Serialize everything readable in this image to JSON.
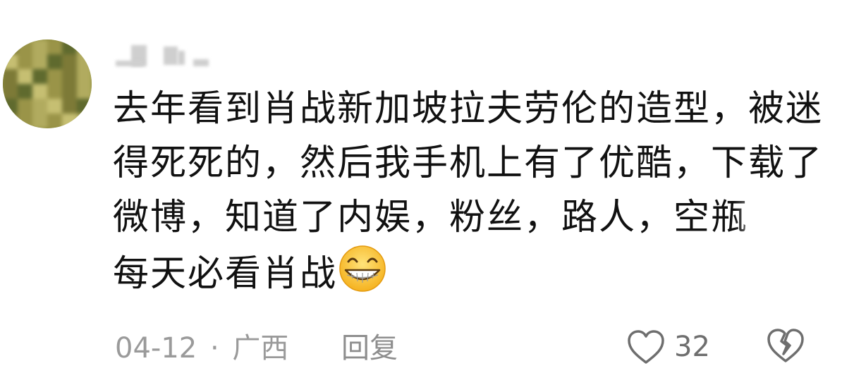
{
  "comment": {
    "avatar_icon": "blurred-user-avatar",
    "username_icon": "blurred-username",
    "lines": [
      "去年看到肖战新加坡拉夫劳伦的造型，被迷",
      "得死死的，然后我手机上有了优酷，下载了",
      "微博，知道了内娱，粉丝，路人，空瓶",
      "每天必看肖战"
    ],
    "emoji": "grinning-face-emoji",
    "date": "04-12",
    "separator": "·",
    "location": "广西",
    "reply_label": "回复",
    "like_icon": "heart-outline-icon",
    "like_count": "32",
    "dislike_icon": "broken-heart-icon"
  }
}
